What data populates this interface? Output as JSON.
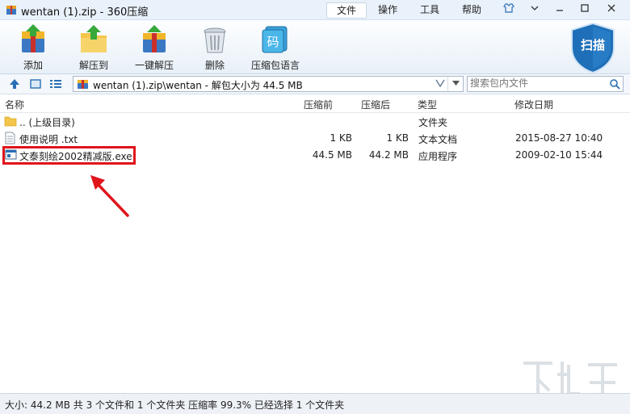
{
  "window": {
    "title": "wentan (1).zip - 360压缩"
  },
  "menu": {
    "file": "文件",
    "operate": "操作",
    "tools": "工具",
    "help": "帮助"
  },
  "toolbar": {
    "add": "添加",
    "extract_to": "解压到",
    "one_click": "一键解压",
    "delete": "删除",
    "language": "压缩包语言",
    "language_icon_text": "码",
    "scan": "扫描"
  },
  "address": {
    "path": "wentan (1).zip\\wentan - 解包大小为 44.5 MB",
    "search_placeholder": "搜索包内文件"
  },
  "columns": {
    "name": "名称",
    "before": "压缩前",
    "after": "压缩后",
    "type": "类型",
    "modified": "修改日期"
  },
  "files": [
    {
      "name": ".. (上级目录)",
      "before": "",
      "after": "",
      "type": "文件夹",
      "modified": "",
      "icon": "folder-icon"
    },
    {
      "name": "使用说明 .txt",
      "before": "1 KB",
      "after": "1 KB",
      "type": "文本文档",
      "modified": "2015-08-27 10:40",
      "icon": "text-file-icon"
    },
    {
      "name": "文泰刻绘2002精减版.exe",
      "before": "44.5 MB",
      "after": "44.2 MB",
      "type": "应用程序",
      "modified": "2009-02-10 15:44",
      "icon": "exe-file-icon"
    }
  ],
  "status": {
    "text": "大小: 44.2 MB 共 3 个文件和 1 个文件夹 压缩率 99.3% 已经选择 1 个文件夹"
  },
  "colors": {
    "highlight": "#e0141c",
    "accent": "#2a6fb5",
    "scan_shield": "#1e6fb8"
  }
}
